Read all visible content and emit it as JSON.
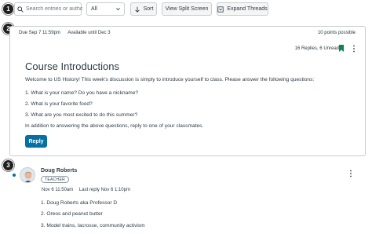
{
  "steps": [
    "1",
    "2",
    "3"
  ],
  "toolbar": {
    "search_placeholder": "Search entries or author",
    "filter_value": "All",
    "sort_label": "Sort",
    "split_screen_label": "View Split Screen",
    "expand_threads_label": "Expand Threads"
  },
  "topic": {
    "due": "Due Sep 7 11:59pm",
    "available": "Available until Dec 3",
    "points": "10 points possible",
    "replies_status": "16 Replies, 6 Unread",
    "title": "Course Introductions",
    "intro": "Welcome to US History! This week's discussion is simply to introduce yourself to class. Please answer the following questions:",
    "questions": [
      "1. What is your name? Do you have a nickname?",
      "2. What is your favorite food?",
      "3. What are you most excited to do this summer?"
    ],
    "closing": "In addition to answering the above questions, reply to one of your classmates.",
    "reply_label": "Reply"
  },
  "entry": {
    "author": "Doug Roberts",
    "role": "TEACHER",
    "posted": "Nov 6 11:50am",
    "last_reply": "Last reply Nov 6 1:10pm",
    "answers": [
      "1. Doug Roberts aka Professor D",
      "2. Oreos and peanut butter",
      "3. Model trains, lacrosse, community activism"
    ]
  },
  "colors": {
    "accent": "#0770a3",
    "bookmark": "#0b874b",
    "text": "#2d3b45",
    "border": "#c7cdd1"
  },
  "icons": [
    "search-icon",
    "chevron-down-icon",
    "sort-arrow-icon",
    "expand-icon",
    "bookmark-icon",
    "kebab-icon"
  ]
}
